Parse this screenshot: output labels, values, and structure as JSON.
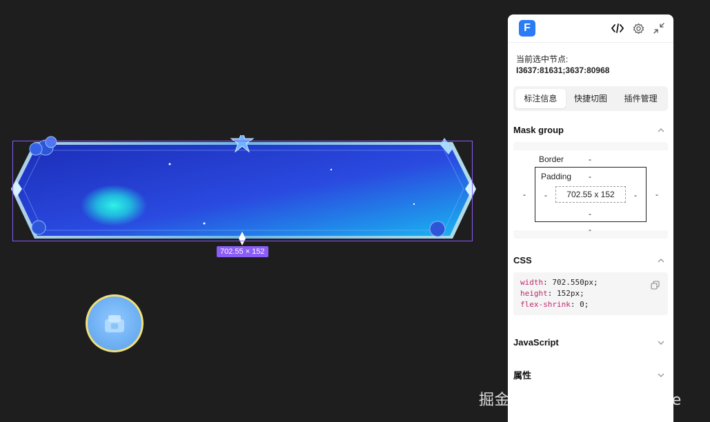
{
  "canvas": {
    "size_tag": "702.55 × 152"
  },
  "panel": {
    "logo_letter": "F",
    "node_label": "当前选中节点:",
    "node_id": "I3637:81631;3637:80968",
    "tabs": [
      {
        "label": "标注信息",
        "active": true
      },
      {
        "label": "快捷切图",
        "active": false
      },
      {
        "label": "插件管理",
        "active": false
      }
    ],
    "sections": {
      "mask_group": "Mask group",
      "css": "CSS",
      "javascript": "JavaScript",
      "attributes": "属性"
    },
    "box_model": {
      "border_label": "Border",
      "padding_label": "Padding",
      "content_size": "702.55 x 152",
      "border_top": "-",
      "padding_top": "-",
      "padding_left": "-",
      "padding_right": "-",
      "padding_bottom": "-",
      "margin_left": "-",
      "margin_right": "-",
      "margin_bottom": "-"
    },
    "css_lines": [
      {
        "prop": "width",
        "value": "702.550px;"
      },
      {
        "prop": "height",
        "value": "152px;"
      },
      {
        "prop": "flex-shrink",
        "value": "0;"
      }
    ]
  },
  "watermark": "掘金技术社区 @ UncleKyrie",
  "colors": {
    "background": "#1e1e1f",
    "selection": "#8b5cf6",
    "accent_blue": "#2a7cf6",
    "css_prop": "#c0266b"
  }
}
